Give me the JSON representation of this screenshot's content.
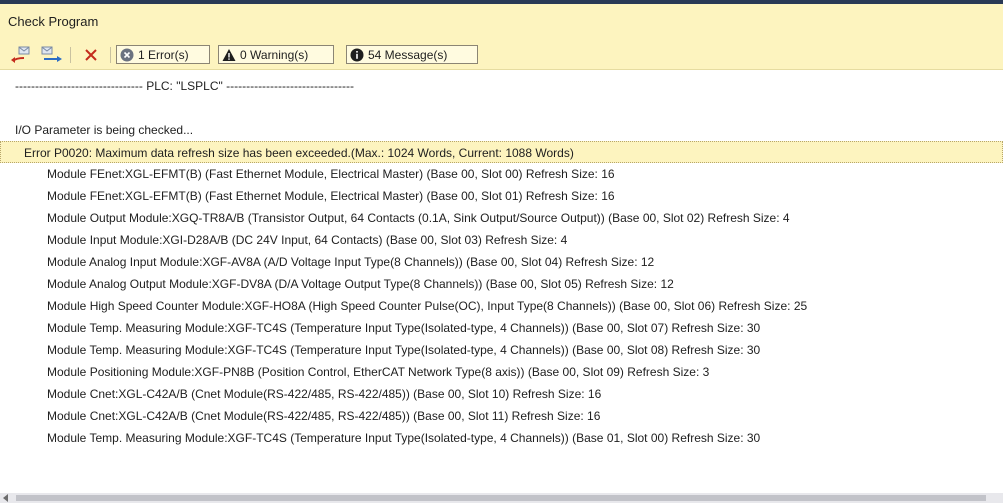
{
  "window": {
    "title": "Check Program"
  },
  "toolbar": {
    "errors_label": "1 Error(s)",
    "warnings_label": "0 Warning(s)",
    "messages_label": "54 Message(s)"
  },
  "colors": {
    "panel_yellow": "#fdf4bf",
    "error_icon": "#6b7280",
    "warning_icon": "#1e1e1e",
    "info_icon": "#1e1e1e",
    "delete_icon": "#c42b1c",
    "nav_arrow": "#c42b1c"
  },
  "icons": {
    "prev": "previous-message-icon",
    "next": "next-message-icon",
    "clear": "clear-x-icon",
    "error": "error-circle-icon",
    "warning": "warning-triangle-icon",
    "info": "info-circle-icon"
  },
  "output": {
    "lines": [
      {
        "text": "-------------------------------- PLC: \"LSPLC\" --------------------------------",
        "indent": 15,
        "kind": "normal"
      },
      {
        "text": "",
        "indent": 15,
        "kind": "blank"
      },
      {
        "text": "I/O Parameter is being checked...",
        "indent": 15,
        "kind": "normal"
      },
      {
        "text": "Error P0020: Maximum data refresh size has been exceeded.(Max.: 1024 Words, Current: 1088 Words)",
        "indent": 23,
        "kind": "error"
      },
      {
        "text": "Module FEnet:XGL-EFMT(B) (Fast Ethernet Module, Electrical Master) (Base 00, Slot 00) Refresh Size: 16",
        "indent": 47,
        "kind": "normal"
      },
      {
        "text": "Module FEnet:XGL-EFMT(B) (Fast Ethernet Module, Electrical Master) (Base 00, Slot 01) Refresh Size: 16",
        "indent": 47,
        "kind": "normal"
      },
      {
        "text": "Module Output Module:XGQ-TR8A/B (Transistor Output, 64 Contacts (0.1A, Sink Output/Source Output)) (Base 00, Slot 02) Refresh Size: 4",
        "indent": 47,
        "kind": "normal"
      },
      {
        "text": "Module Input Module:XGI-D28A/B (DC 24V Input, 64 Contacts) (Base 00, Slot 03) Refresh Size: 4",
        "indent": 47,
        "kind": "normal"
      },
      {
        "text": "Module Analog Input Module:XGF-AV8A (A/D Voltage Input Type(8 Channels)) (Base 00, Slot 04) Refresh Size: 12",
        "indent": 47,
        "kind": "normal"
      },
      {
        "text": "Module Analog Output Module:XGF-DV8A (D/A Voltage Output Type(8 Channels)) (Base 00, Slot 05) Refresh Size: 12",
        "indent": 47,
        "kind": "normal"
      },
      {
        "text": "Module High Speed Counter Module:XGF-HO8A (High Speed Counter Pulse(OC), Input Type(8 Channels)) (Base 00, Slot 06) Refresh Size: 25",
        "indent": 47,
        "kind": "normal"
      },
      {
        "text": "Module Temp. Measuring Module:XGF-TC4S (Temperature Input Type(Isolated-type, 4 Channels)) (Base 00, Slot 07) Refresh Size: 30",
        "indent": 47,
        "kind": "normal"
      },
      {
        "text": "Module Temp. Measuring Module:XGF-TC4S (Temperature Input Type(Isolated-type, 4 Channels)) (Base 00, Slot 08) Refresh Size: 30",
        "indent": 47,
        "kind": "normal"
      },
      {
        "text": "Module Positioning Module:XGF-PN8B (Position Control, EtherCAT Network Type(8 axis)) (Base 00, Slot 09) Refresh Size: 3",
        "indent": 47,
        "kind": "normal"
      },
      {
        "text": "Module Cnet:XGL-C42A/B (Cnet Module(RS-422/485, RS-422/485)) (Base 00, Slot 10) Refresh Size: 16",
        "indent": 47,
        "kind": "normal"
      },
      {
        "text": "Module Cnet:XGL-C42A/B (Cnet Module(RS-422/485, RS-422/485)) (Base 00, Slot 11) Refresh Size: 16",
        "indent": 47,
        "kind": "normal"
      },
      {
        "text": "Module Temp. Measuring Module:XGF-TC4S (Temperature Input Type(Isolated-type, 4 Channels)) (Base 01, Slot 00) Refresh Size: 30",
        "indent": 47,
        "kind": "normal"
      }
    ]
  }
}
